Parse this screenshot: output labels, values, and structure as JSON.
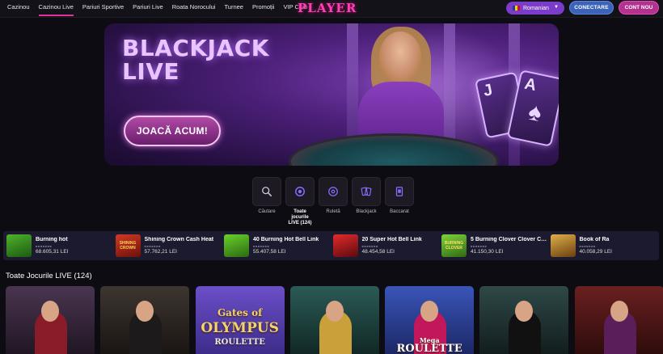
{
  "nav": {
    "items": [
      {
        "label": "Cazinou",
        "active": false
      },
      {
        "label": "Cazinou Live",
        "active": true
      },
      {
        "label": "Pariuri Sportive",
        "active": false
      },
      {
        "label": "Pariuri Live",
        "active": false
      },
      {
        "label": "Roata Norocului",
        "active": false
      },
      {
        "label": "Turnee",
        "active": false
      },
      {
        "label": "Promoții",
        "active": false
      },
      {
        "label": "VIP Club",
        "active": false
      }
    ],
    "logo": "PLAYER",
    "language": "Romanian",
    "login_label": "CONECTARE",
    "register_label": "CONT NOU"
  },
  "hero": {
    "title_line1": "BLACKJACK",
    "title_line2": "LIVE",
    "cta_label": "JOACĂ ACUM!",
    "card1": "J",
    "card2": "A"
  },
  "categories": [
    {
      "label": "Căutare",
      "icon": "search-icon",
      "active": false
    },
    {
      "label": "Toate jocurile LIVE (124)",
      "icon": "chip-icon",
      "active": true
    },
    {
      "label": "Ruletă",
      "icon": "roulette-icon",
      "active": false
    },
    {
      "label": "Blackjack",
      "icon": "cards-icon",
      "active": false
    },
    {
      "label": "Baccarat",
      "icon": "card-icon",
      "active": false
    }
  ],
  "jackpots": [
    {
      "name": "Burning hot",
      "amount": "68.605,31 LEI",
      "color": "#2f7a1d"
    },
    {
      "name": "Shining Crown Cash Heat",
      "amount": "57.762,21 LEI",
      "color": "#9b1d16"
    },
    {
      "name": "40 Burning Hot Bell Link",
      "amount": "55.407,58 LEI",
      "color": "#3a8a1e"
    },
    {
      "name": "20 Super Hot Bell Link",
      "amount": "48.454,58 LEI",
      "color": "#a3141b"
    },
    {
      "name": "5 Burning Clover Clover Ch...",
      "amount": "41.150,30 LEI",
      "color": "#4f8f1a"
    },
    {
      "name": "Book of Ra",
      "amount": "40.058,29 LEI",
      "color": "#b07a22"
    }
  ],
  "section": {
    "title": "Toate Jocurile LIVE (124)"
  },
  "games": [
    {
      "bg": "#3b2a3a",
      "text": ""
    },
    {
      "bg": "#2e2a2a",
      "text": ""
    },
    {
      "bg": "#5a3fa0",
      "text_top": "Gates of",
      "text_mid": "OLYMPUS",
      "text_bot": "ROULETTE"
    },
    {
      "bg": "#1f4a45",
      "text": ""
    },
    {
      "bg": "#2c3f8f",
      "text_top": "Mega",
      "text_mid": "ROULETTE"
    },
    {
      "bg": "#243a3a",
      "text": ""
    },
    {
      "bg": "#4a1818",
      "text": ""
    }
  ],
  "jackpot_thumb_text": [
    "",
    "SHINING CROWN",
    "",
    "",
    "BURNING CLOVER",
    ""
  ]
}
